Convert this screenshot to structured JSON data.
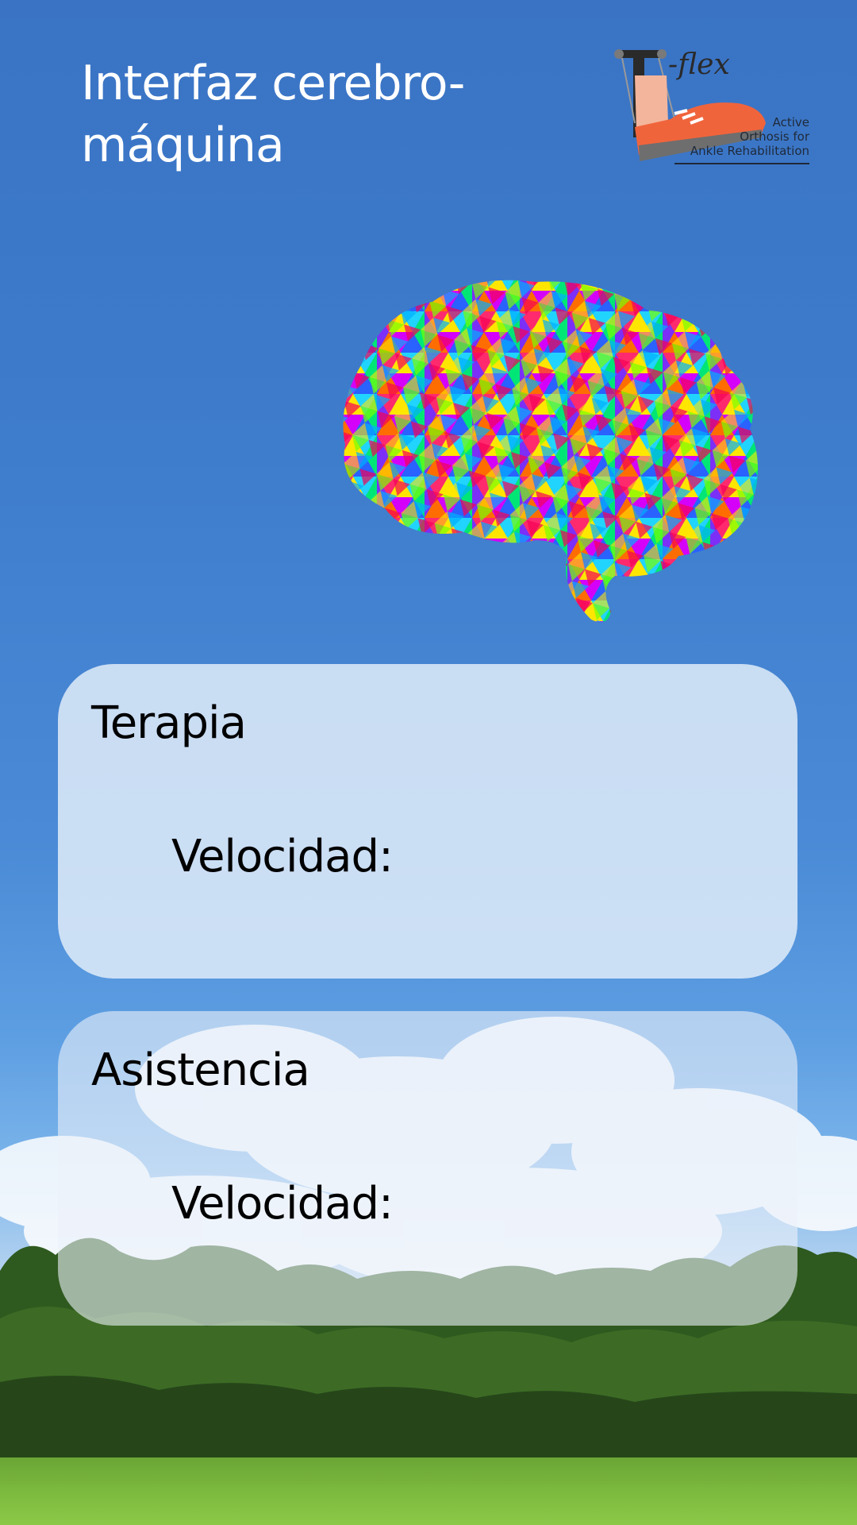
{
  "header": {
    "title": "Interfaz cerebro-máquina"
  },
  "logo": {
    "brand": "T-flex",
    "tagline_lines": [
      "Active",
      "Orthosis for",
      "Ankle Rehabilitation"
    ]
  },
  "cards": [
    {
      "title": "Terapia",
      "label": "Velocidad:",
      "value": ""
    },
    {
      "title": "Asistencia",
      "label": "Velocidad:",
      "value": ""
    }
  ],
  "colors": {
    "sky_top": "#3a73c4",
    "card_bg": "#e6f0fa",
    "title_text": "#ffffff",
    "shoe_accent": "#f0643c"
  },
  "icons": {
    "brain": "brain-icon",
    "logo_shoe": "shoe-icon"
  }
}
